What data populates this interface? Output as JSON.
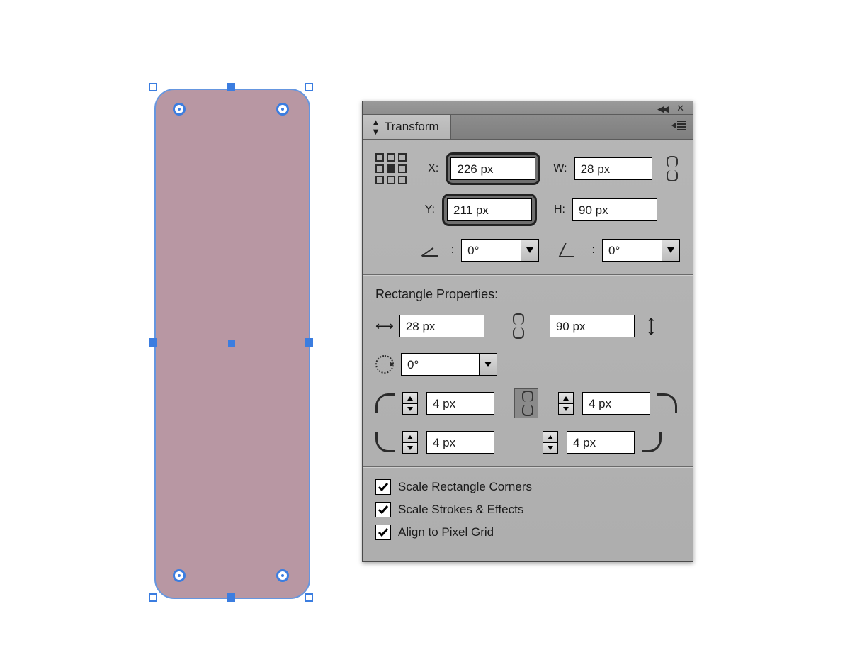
{
  "canvas": {
    "shape_fill": "#b897a3",
    "selection_color": "#3b7de0",
    "corner_radius_px": 28
  },
  "panel": {
    "title": "Transform",
    "section_label": "Rectangle Properties:",
    "labels": {
      "x": "X:",
      "y": "Y:",
      "w": "W:",
      "h": "H:"
    },
    "position": {
      "x": "226 px",
      "y": "211 px"
    },
    "size": {
      "w": "28 px",
      "h": "90 px"
    },
    "rotate": "0°",
    "shear": "0°",
    "rect": {
      "width": "28 px",
      "height": "90 px",
      "angle": "0°",
      "corners": {
        "tl": "4 px",
        "tr": "4 px",
        "bl": "4 px",
        "br": "4 px"
      }
    },
    "options": {
      "scale_corners": "Scale Rectangle Corners",
      "scale_strokes": "Scale Strokes & Effects",
      "align_pixel": "Align to Pixel Grid",
      "scale_corners_checked": true,
      "scale_strokes_checked": true,
      "align_pixel_checked": true
    }
  }
}
